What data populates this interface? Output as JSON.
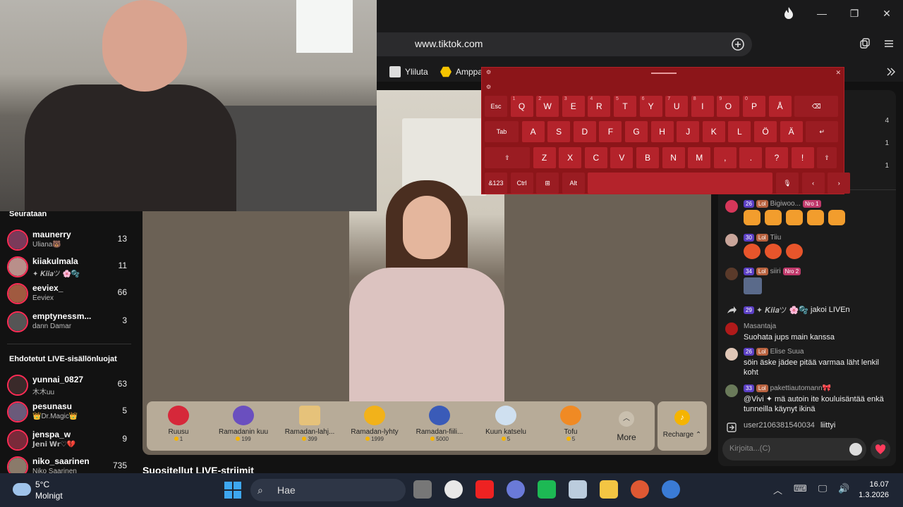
{
  "browser": {
    "url": "www.tiktok.com",
    "bookmarks": [
      "Yliluta",
      "Amppa"
    ],
    "window_controls": [
      "—",
      "❐",
      "✕"
    ]
  },
  "sidebar": {
    "following_header": "Seurataan",
    "following": [
      {
        "name": "maunerry",
        "sub": "Uliana🐻",
        "count": "13"
      },
      {
        "name": "kiiakulmala",
        "sub": "✦ 𝑲𝒊𝒊𝒂ツ 🌸🫧",
        "count": "11"
      },
      {
        "name": "eeviex_",
        "sub": "Eeviex",
        "count": "66"
      },
      {
        "name": "emptynessm...",
        "sub": "dann Damar",
        "count": "3"
      }
    ],
    "suggested_header": "Ehdotetut LIVE-sisällönluojat",
    "suggested": [
      {
        "name": "yunnai_0827",
        "sub": "木木uu",
        "count": "63"
      },
      {
        "name": "pesunasu",
        "sub": "👑Dr.Magic👑",
        "count": "5"
      },
      {
        "name": "jenspa_w",
        "sub": "𝗝𝗲𝗻𝗶 𝗪𝗿♡💔",
        "count": "9"
      },
      {
        "name": "niko_saarinen",
        "sub": "Niko Saarinen",
        "count": "735"
      }
    ]
  },
  "gifts": [
    {
      "name": "Ruusu",
      "price": "1",
      "color": "#d6283a"
    },
    {
      "name": "Ramadanin kuu",
      "price": "199",
      "color": "#6a4fbf"
    },
    {
      "name": "Ramadan-lahj...",
      "price": "399",
      "color": "#e6c27a"
    },
    {
      "name": "Ramadan-lyhty",
      "price": "1999",
      "color": "#f2b21a"
    },
    {
      "name": "Ramadan-fiili...",
      "price": "5000",
      "color": "#3a5bb8"
    },
    {
      "name": "Kuun katselu",
      "price": "5",
      "color": "#cfe0f0"
    },
    {
      "name": "Tofu",
      "price": "5",
      "color": "#f08a24"
    }
  ],
  "gift_more": "More",
  "recharge": "Recharge ⌃",
  "suggested_streams": "Suositellut LIVE-striimit",
  "chat": {
    "rank_numbers": [
      "4",
      "1",
      "1"
    ],
    "messages": [
      {
        "badge_level": "26",
        "badge_lol": "Lol",
        "user": "Bigiwoo...",
        "nro": "Nro 1",
        "type": "gold-gifts"
      },
      {
        "badge_level": "30",
        "badge_lol": "Lol",
        "user": "Tiiu",
        "type": "red-gifts"
      },
      {
        "badge_level": "34",
        "badge_lol": "Lol",
        "user": "siiri",
        "nro": "Nro 2",
        "type": "image"
      },
      {
        "badge_level": "29",
        "user": "✦ 𝑲𝒊𝒊𝒂ツ 🌸🫧",
        "text": "jakoi LIVEn",
        "type": "share"
      },
      {
        "user": "Masantaja",
        "text": "Suohata jups main kanssa"
      },
      {
        "badge_level": "26",
        "badge_lol": "Lol",
        "user": "Elise Suua",
        "text": "söin äske jädee pitää varmaa läht lenkil koht"
      },
      {
        "badge_level": "33",
        "badge_lol": "Lol",
        "user": "pakettiautomann🎀",
        "text": "@Vivi ✦ mä autoin ite kouluisäntää enkä tunneilla käynyt ikinä"
      },
      {
        "user": "user2106381540034",
        "text": "liittyi",
        "type": "join"
      }
    ],
    "input_placeholder": "Kirjoita...(C)"
  },
  "keyboard": {
    "rows": [
      [
        "Esc",
        "Q",
        "W",
        "E",
        "R",
        "T",
        "Y",
        "U",
        "I",
        "O",
        "P",
        "Å",
        "⌫"
      ],
      [
        "Tab",
        "A",
        "S",
        "D",
        "F",
        "G",
        "H",
        "J",
        "K",
        "L",
        "Ö",
        "Ä",
        "↵"
      ],
      [
        "⇧",
        "Z",
        "X",
        "C",
        "V",
        "B",
        "N",
        "M",
        ",",
        ".",
        "?",
        "!",
        "⇧"
      ],
      [
        "&123",
        "Ctrl",
        "⊞",
        "Alt",
        "",
        "🎙",
        "‹",
        "›"
      ]
    ],
    "alt_digits": [
      "1",
      "2",
      "3",
      "4",
      "5",
      "6",
      "7",
      "8",
      "9",
      "0"
    ]
  },
  "taskbar": {
    "temp": "5°C",
    "weather": "Molnigt",
    "search": "Hae",
    "time": "16.07",
    "date": "1.3.2026"
  }
}
